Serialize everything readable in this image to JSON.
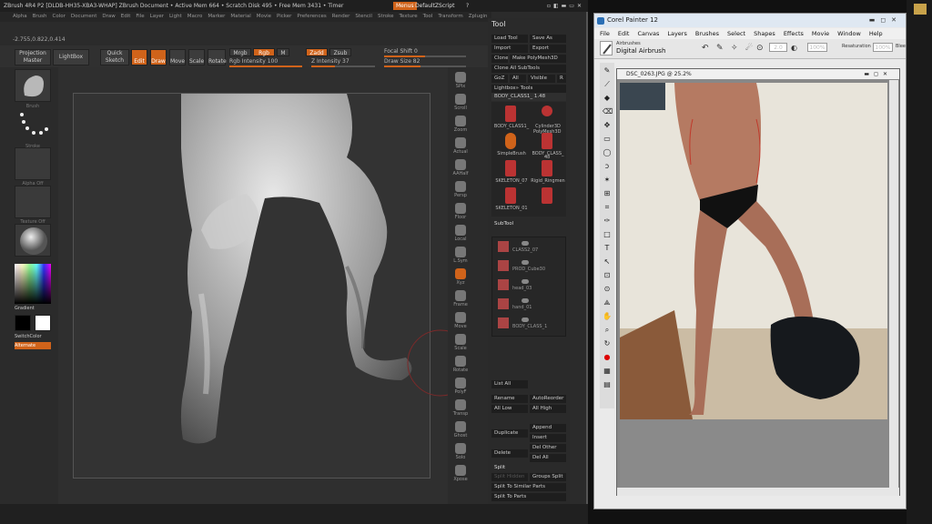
{
  "zbrush": {
    "title": "ZBrush 4R4 P2 [DLDB-HH35-XBA3-WHAP]   ZBrush Document    • Active Mem 664 • Scratch Disk 495 • Free Mem 3431 • Timer",
    "menus_label": "Menus",
    "default_script": "DefaultZScript",
    "menubar": [
      "Alpha",
      "Brush",
      "Color",
      "Document",
      "Draw",
      "Edit",
      "File",
      "Layer",
      "Light",
      "Macro",
      "Marker",
      "Material",
      "Movie",
      "Picker",
      "Preferences",
      "Render",
      "Stencil",
      "Stroke",
      "Texture",
      "Tool",
      "Transform",
      "Zplugin"
    ],
    "coords": "-2.755,0.822,0.414",
    "topshelf": {
      "projection_master": "Projection Master",
      "lightbox": "LightBox",
      "quick_sketch": "Quick Sketch",
      "edit": "Edit",
      "draw": "Draw",
      "move": "Move",
      "scale": "Scale",
      "rotate": "Rotate",
      "mrgb": "Mrgb",
      "rgb": "Rgb",
      "m": "M",
      "zadd": "Zadd",
      "zsub": "Zsub",
      "rgb_intensity": "Rgb Intensity 100",
      "z_intensity": "Z Intensity 37",
      "focal_shift": "Focal Shift 0",
      "draw_size": "Draw Size 82"
    },
    "leftpanel": {
      "brush_caption": "Brush",
      "stroke_caption": "Stroke",
      "alpha_caption": "Alpha Off",
      "texture_caption": "Texture Off",
      "gradient": "Gradient",
      "switch_color": "SwitchColor",
      "alternate": "Alternate"
    },
    "rightshelf": [
      "SPix",
      "Scroll",
      "Zoom",
      "Actual",
      "AAHalf",
      "Persp",
      "Floor",
      "Local",
      "L.Sym",
      "Xyz",
      "Frame",
      "Move",
      "Scale",
      "Rotate",
      "PolyF",
      "Transp",
      "Ghost",
      "Solo",
      "Xpose"
    ],
    "tool": {
      "header": "Tool",
      "load_tool": "Load Tool",
      "save_as": "Save As",
      "import": "Import",
      "export": "Export",
      "clone": "Clone",
      "make_polymesh": "Make PolyMesh3D",
      "clone_all": "Clone All SubTools",
      "goz": "GoZ",
      "all": "All",
      "visible": "Visible",
      "r": "R",
      "lightbox_tools": "Lightbox» Tools",
      "current_tool": "BODY_CLASS1_  1.48",
      "thumbs": [
        "BODY_CLASS1_",
        "Cylinder3D",
        "SimpleBrush",
        "BODY_CLASS_",
        "SKELETON_07",
        "Rigid_Ringmen",
        "SKELETON_01",
        ""
      ],
      "thumb_captions_extra": [
        "PolyMesh3D",
        "48"
      ],
      "subtool_header": "SubTool",
      "subtools": [
        "CLASS2_07",
        "PROD_Cube30",
        "head_03",
        "hand_01",
        "BODY_CLASS_1"
      ],
      "list_all": "List All",
      "rename": "Rename",
      "autoreorder": "AutoReorder",
      "all_low": "All Low",
      "all_high": "All High",
      "duplicate": "Duplicate",
      "append": "Append",
      "insert": "Insert",
      "delete": "Delete",
      "del_other": "Del Other",
      "del_all": "Del All",
      "split": "Split",
      "split_hidden": "Split Hidden",
      "groups_split": "Groups Split",
      "split_similar": "Split To Similar Parts",
      "split_parts": "Split To Parts"
    }
  },
  "painter": {
    "title": "Corel Painter 12",
    "menubar": [
      "File",
      "Edit",
      "Canvas",
      "Layers",
      "Brushes",
      "Select",
      "Shapes",
      "Effects",
      "Movie",
      "Window",
      "Help"
    ],
    "brush_category": "Airbrushes",
    "brush_variant": "Digital Airbrush",
    "size_value": "2.0",
    "opacity_value": "100%",
    "resaturation_label": "Resaturation",
    "resaturation_value": "100%",
    "bleed_label": "Blee",
    "doc_title": "DSC_0263.JPG @ 25.2%",
    "accent": "#2b6fb5"
  }
}
